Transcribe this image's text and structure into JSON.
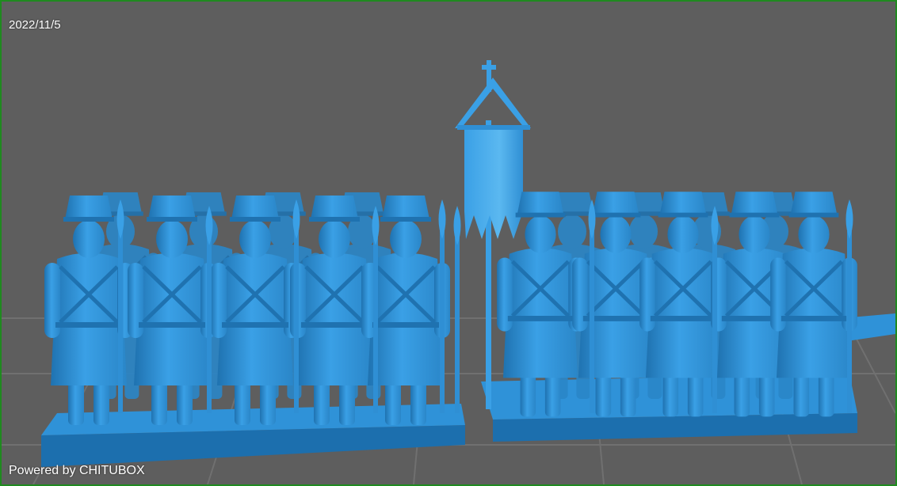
{
  "viewer": {
    "date": "2022/11/5",
    "watermark": "Powered by CHITUBOX"
  },
  "colors": {
    "background": "#5e5e5e",
    "grid": "#6d6d6d",
    "frame": "#1f8a1f",
    "model": "#3aa0e6",
    "model_dark": "#1f72b0",
    "model_light": "#6cc2f5",
    "base": "#2f92d8",
    "base_side": "#1c6fae"
  },
  "scene": {
    "model": "miniature-infantry-regiment",
    "icon": "figure-icon"
  }
}
